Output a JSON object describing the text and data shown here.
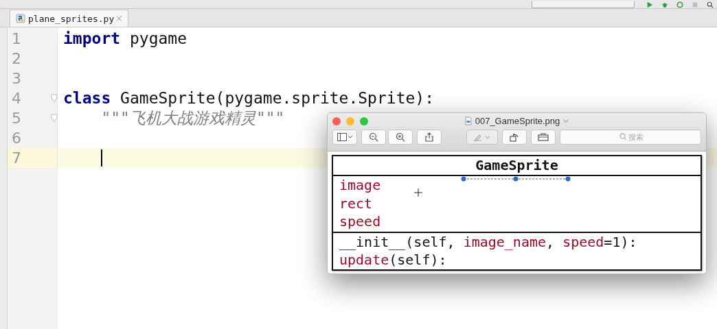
{
  "tabs": [
    {
      "label": "plane_sprites.py",
      "selected": true
    }
  ],
  "editor": {
    "lines": [
      {
        "number": "1",
        "current": false,
        "caret": false,
        "fold": false,
        "tokens": [
          {
            "text": "import",
            "kind": "keyword"
          },
          {
            "text": " pygame",
            "kind": "plain"
          }
        ]
      },
      {
        "number": "2",
        "current": false,
        "caret": false,
        "fold": false
      },
      {
        "number": "3",
        "current": false,
        "caret": false,
        "fold": false
      },
      {
        "number": "4",
        "current": false,
        "caret": false,
        "fold": true,
        "tokens": [
          {
            "text": "class",
            "kind": "keyword"
          },
          {
            "text": " GameSprite(pygame.sprite.Sprite):",
            "kind": "plain"
          }
        ]
      },
      {
        "number": "5",
        "current": false,
        "caret": false,
        "fold": true,
        "tokens": [
          {
            "text": "    \"\"\"飞机大战游戏精灵\"\"\"",
            "kind": "docstring"
          }
        ]
      },
      {
        "number": "6",
        "current": false,
        "caret": false,
        "fold": false
      },
      {
        "number": "7",
        "current": true,
        "caret": true,
        "fold": false
      }
    ]
  },
  "preview": {
    "title": "007_GameSprite.png",
    "search": {
      "placeholder": "搜索"
    },
    "diagram": {
      "class_name": "GameSprite",
      "attributes": [
        "image",
        "rect",
        "speed"
      ],
      "methods": [
        [
          {
            "text": "__init__(self, ",
            "kind": "plain"
          },
          {
            "text": "image_name",
            "kind": "name"
          },
          {
            "text": ", ",
            "kind": "plain"
          },
          {
            "text": "speed",
            "kind": "name"
          },
          {
            "text": "=1):",
            "kind": "plain"
          }
        ],
        [
          {
            "text": "update",
            "kind": "name"
          },
          {
            "text": "(self):",
            "kind": "plain"
          }
        ]
      ]
    }
  }
}
